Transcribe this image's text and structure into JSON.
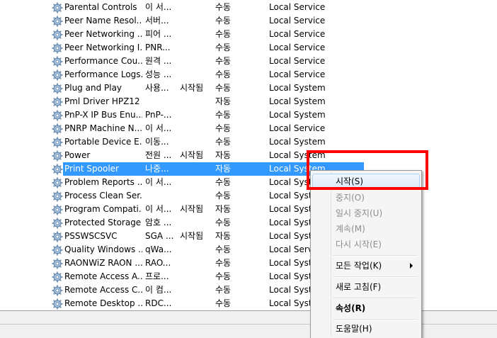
{
  "services": [
    {
      "name": "Parental Controls",
      "description": "이 서...",
      "status": "",
      "startup": "수동",
      "logon": "Local Service"
    },
    {
      "name": "Peer Name Resol...",
      "description": "서버...",
      "status": "",
      "startup": "수동",
      "logon": "Local Service"
    },
    {
      "name": "Peer Networking ...",
      "description": "피어 ...",
      "status": "",
      "startup": "수동",
      "logon": "Local Service"
    },
    {
      "name": "Peer Networking I...",
      "description": "PNR...",
      "status": "",
      "startup": "수동",
      "logon": "Local Service"
    },
    {
      "name": "Performance Cou...",
      "description": "원격 ...",
      "status": "",
      "startup": "수동",
      "logon": "Local Service"
    },
    {
      "name": "Performance Logs...",
      "description": "성능 ...",
      "status": "",
      "startup": "수동",
      "logon": "Local Service"
    },
    {
      "name": "Plug and Play",
      "description": "사용...",
      "status": "시작됨",
      "startup": "수동",
      "logon": "Local System"
    },
    {
      "name": "Pml Driver HPZ12",
      "description": "",
      "status": "",
      "startup": "자동",
      "logon": "Local System"
    },
    {
      "name": "PnP-X IP Bus Enu...",
      "description": "PnP-...",
      "status": "",
      "startup": "수동",
      "logon": "Local System"
    },
    {
      "name": "PNRP Machine N...",
      "description": "이 서...",
      "status": "",
      "startup": "수동",
      "logon": "Local Service"
    },
    {
      "name": "Portable Device E...",
      "description": "이동...",
      "status": "",
      "startup": "수동",
      "logon": "Local System"
    },
    {
      "name": "Power",
      "description": "전원 ...",
      "status": "시작됨",
      "startup": "자동",
      "logon": "Local System"
    },
    {
      "name": "Print Spooler",
      "description": "나중...",
      "status": "",
      "startup": "자동",
      "logon": "Local System"
    },
    {
      "name": "Problem Reports ...",
      "description": "이 서...",
      "status": "",
      "startup": "수동",
      "logon": "Local Syste"
    },
    {
      "name": "Process Clean Ser...",
      "description": "",
      "status": "",
      "startup": "수동",
      "logon": "Local Syste"
    },
    {
      "name": "Program Compati...",
      "description": "이 서...",
      "status": "시작됨",
      "startup": "자동",
      "logon": "Local Syste"
    },
    {
      "name": "Protected Storage",
      "description": "암호 ...",
      "status": "",
      "startup": "수동",
      "logon": "Local Syste"
    },
    {
      "name": "PSSWSCSVC",
      "description": "SGA ...",
      "status": "시작됨",
      "startup": "자동",
      "logon": "Local Syste"
    },
    {
      "name": "Quality Windows ...",
      "description": "qWa...",
      "status": "",
      "startup": "수동",
      "logon": "Local Servi"
    },
    {
      "name": "RAONWiZ RAON ...",
      "description": "RAO...",
      "status": "",
      "startup": "수동",
      "logon": "Local Syste"
    },
    {
      "name": "Remote Access A...",
      "description": "프로...",
      "status": "",
      "startup": "수동",
      "logon": "Local Syste"
    },
    {
      "name": "Remote Access C...",
      "description": "이 컴...",
      "status": "",
      "startup": "수동",
      "logon": "Local Syste"
    },
    {
      "name": "Remote Desktop ...",
      "description": "RDC...",
      "status": "",
      "startup": "수동",
      "logon": "Local Syste"
    }
  ],
  "context_menu": {
    "start": "시작(S)",
    "stop": "중지(O)",
    "pause": "일시 중지(U)",
    "resume": "계속(M)",
    "restart": "다시 시작(E)",
    "all_tasks": "모든 작업(K)",
    "refresh": "새로 고침(F)",
    "properties": "속성(R)",
    "help": "도움말(H)"
  },
  "colors": {
    "selection": "#3399ff",
    "highlight_box": "#ff0000"
  },
  "icons": {
    "service": "gear-icon",
    "submenu": "chevron-right-icon"
  }
}
